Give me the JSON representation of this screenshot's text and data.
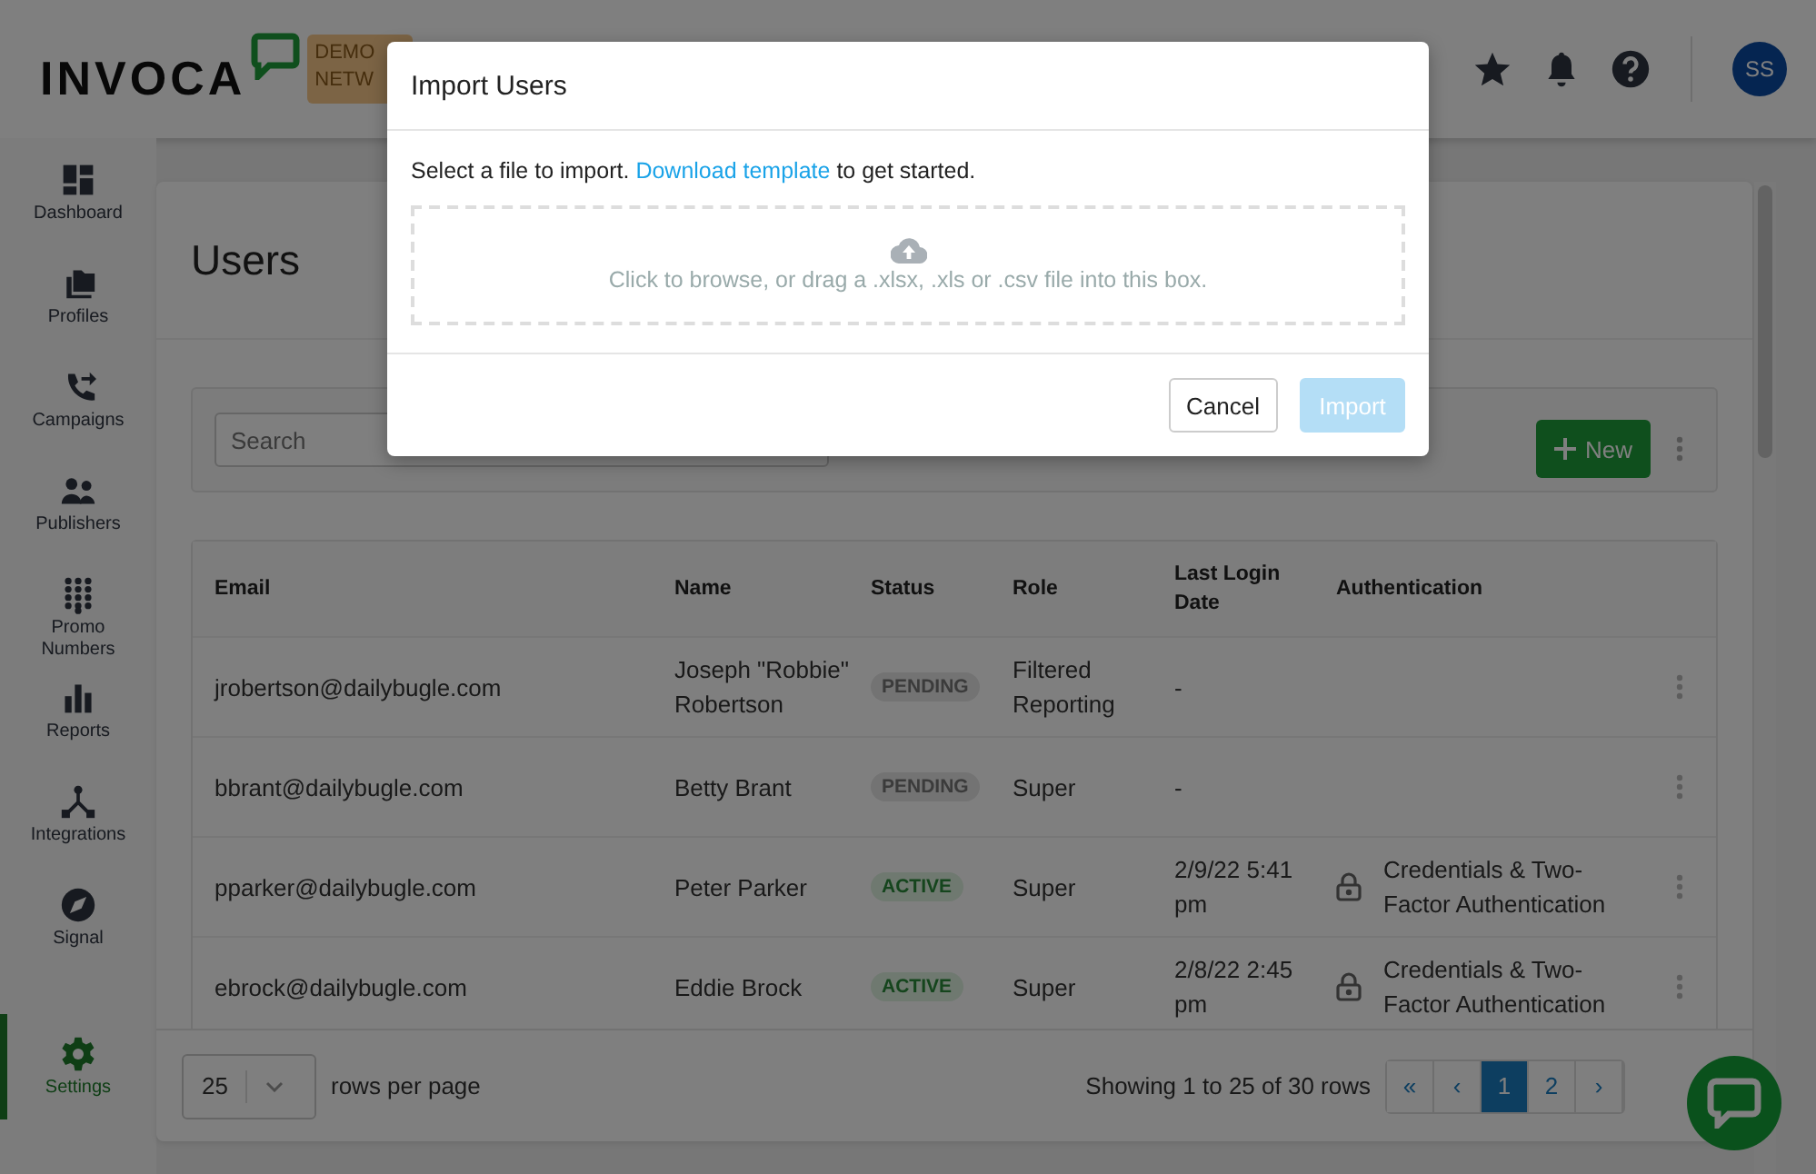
{
  "header": {
    "logo": "INVOCA",
    "badge_lines": [
      "DEMO",
      "NETW"
    ],
    "avatar": "SS"
  },
  "sidebar": {
    "items": [
      {
        "label": "Dashboard",
        "selected": false
      },
      {
        "label": "Profiles",
        "selected": false
      },
      {
        "label": "Campaigns",
        "selected": false
      },
      {
        "label": "Publishers",
        "selected": false
      },
      {
        "label": "Promo Numbers",
        "selected": false
      },
      {
        "label": "Reports",
        "selected": false
      },
      {
        "label": "Integrations",
        "selected": false
      },
      {
        "label": "Signal",
        "selected": false
      },
      {
        "label": "Settings",
        "selected": true
      }
    ]
  },
  "page": {
    "title": "Users"
  },
  "toolbar": {
    "search": {
      "placeholder": "Search"
    },
    "new_button": "New"
  },
  "table": {
    "columns": [
      "Email",
      "Name",
      "Status",
      "Role",
      "Last Login Date",
      "Authentication"
    ],
    "rows": [
      {
        "email": "jrobertson@dailybugle.com",
        "name": "Joseph \"Robbie\" Robertson",
        "status": {
          "label": "PENDING",
          "kind": "pending"
        },
        "role": "Filtered Reporting",
        "last_login": "-"
      },
      {
        "email": "bbrant@dailybugle.com",
        "name": "Betty Brant",
        "status": {
          "label": "PENDING",
          "kind": "pending"
        },
        "role": "Super",
        "last_login": "-"
      },
      {
        "email": "pparker@dailybugle.com",
        "name": "Peter Parker",
        "status": {
          "label": "ACTIVE",
          "kind": "active"
        },
        "role": "Super",
        "last_login": "2/9/22 5:41 pm",
        "authentication": "Credentials & Two-Factor Authentication"
      },
      {
        "email": "ebrock@dailybugle.com",
        "name": "Eddie Brock",
        "status": {
          "label": "ACTIVE",
          "kind": "active"
        },
        "role": "Super",
        "last_login": "2/8/22 2:45 pm",
        "authentication": "Credentials & Two-Factor Authentication"
      }
    ]
  },
  "footer": {
    "page_size": "25",
    "rows_label": "rows per page",
    "summary": "Showing 1 to 25 of 30 rows",
    "pages": [
      {
        "label": "«",
        "selected": false
      },
      {
        "label": "‹",
        "selected": false
      },
      {
        "label": "1",
        "selected": true
      },
      {
        "label": "2",
        "selected": false
      },
      {
        "label": "›",
        "selected": false
      }
    ]
  },
  "modal": {
    "title": "Import Users",
    "intro_before": "Select a file to import.",
    "link": "Download template",
    "intro_after": "to get started.",
    "drop_hint": "Click to browse, or drag a .xlsx, .xls or .csv file into this box.",
    "buttons": [
      {
        "label": "Cancel",
        "kind": "secondary",
        "disabled": false
      },
      {
        "label": "Import",
        "kind": "primary",
        "disabled": true
      }
    ]
  }
}
